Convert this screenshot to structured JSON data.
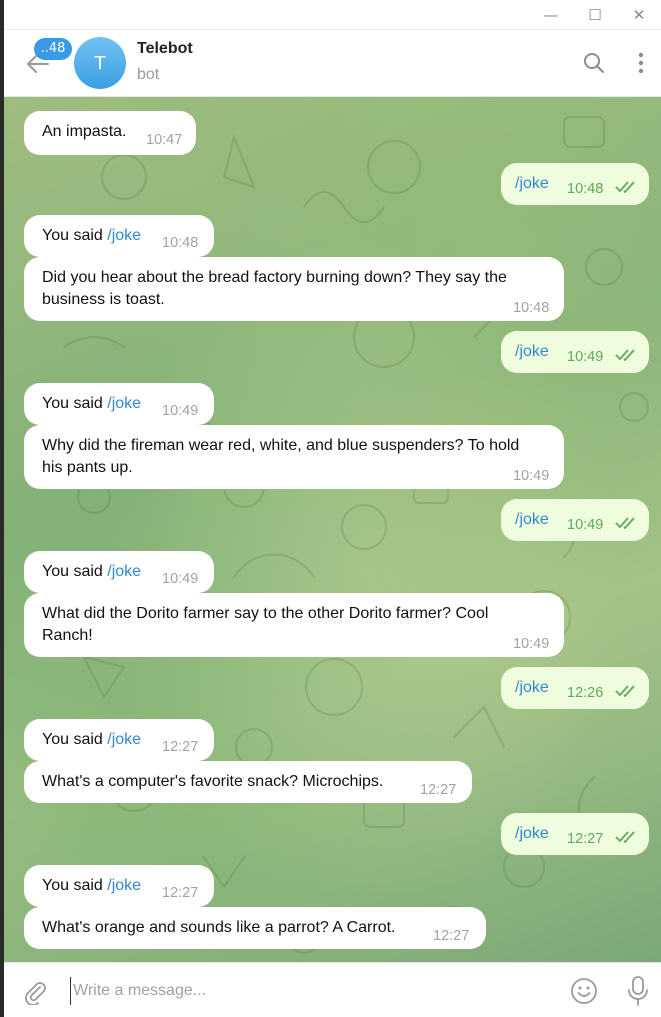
{
  "window": {
    "controls": [
      "—",
      "☐",
      "✕"
    ]
  },
  "header": {
    "unread_badge": "..48",
    "avatar_letter": "T",
    "title": "Telebot",
    "subtitle": "bot"
  },
  "messages": [
    {
      "side": "in",
      "text": "An impasta.",
      "time": "10:47"
    },
    {
      "side": "out",
      "text": "/joke",
      "time": "10:48"
    },
    {
      "side": "in",
      "prefix": "You said ",
      "cmd": "/joke",
      "time": "10:48"
    },
    {
      "side": "in",
      "line1": "Did you hear about the bread factory burning down? They say the",
      "line2": "business is toast.",
      "time": "10:48"
    },
    {
      "side": "out",
      "text": "/joke",
      "time": "10:49"
    },
    {
      "side": "in",
      "prefix": "You said ",
      "cmd": "/joke",
      "time": "10:49"
    },
    {
      "side": "in",
      "line1": "Why did the fireman wear red, white, and blue suspenders? To hold",
      "line2": "his pants up.",
      "time": "10:49"
    },
    {
      "side": "out",
      "text": "/joke",
      "time": "10:49"
    },
    {
      "side": "in",
      "prefix": "You said ",
      "cmd": "/joke",
      "time": "10:49"
    },
    {
      "side": "in",
      "line1": "What did the Dorito farmer say to the other Dorito farmer? Cool",
      "line2": "Ranch!",
      "time": "10:49"
    },
    {
      "side": "out",
      "text": "/joke",
      "time": "12:26"
    },
    {
      "side": "in",
      "prefix": "You said ",
      "cmd": "/joke",
      "time": "12:27"
    },
    {
      "side": "in",
      "text": "What's a computer's favorite snack? Microchips.",
      "time": "12:27"
    },
    {
      "side": "out",
      "text": "/joke",
      "time": "12:27"
    },
    {
      "side": "in",
      "prefix": "You said ",
      "cmd": "/joke",
      "time": "12:27"
    },
    {
      "side": "in",
      "text": "What's orange and sounds like a parrot? A Carrot.",
      "time": "12:27"
    }
  ],
  "composer": {
    "placeholder": "Write a message..."
  },
  "colors": {
    "accent": "#3b9ae8",
    "outgoing_bubble": "#effdde",
    "command_link": "#2f88d0",
    "read_ticks": "#5fa85d"
  },
  "icons": [
    "back-arrow-icon",
    "search-icon",
    "more-vertical-icon",
    "attach-paperclip-icon",
    "emoji-icon",
    "microphone-icon",
    "double-check-icon"
  ]
}
